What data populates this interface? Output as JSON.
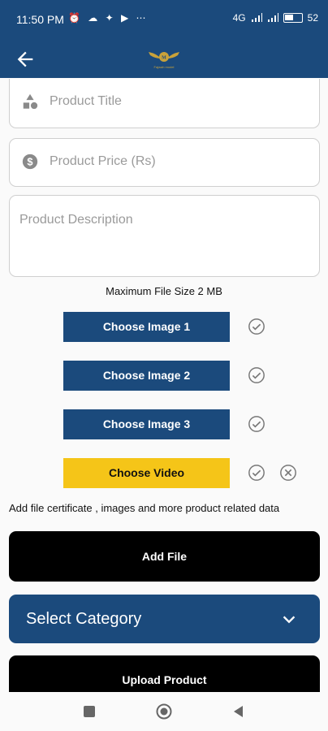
{
  "status_bar": {
    "time": "11:50 PM",
    "icons": "⏰ ☁ ✦ ▶ ⋯",
    "network": "4G",
    "battery": "52"
  },
  "app_bar": {
    "logo_text": "Fajwah model"
  },
  "form": {
    "title_placeholder": "Product Title",
    "price_placeholder": "Product Price (Rs)",
    "description_placeholder": "Product Description",
    "max_size_note": "Maximum File Size 2 MB",
    "choose_image_1": "Choose Image 1",
    "choose_image_2": "Choose Image 2",
    "choose_image_3": "Choose Image 3",
    "choose_video": "Choose Video",
    "file_note": "Add file certificate , images and more product related data",
    "add_file": "Add File",
    "select_category": "Select Category",
    "upload_product": "Upload Product"
  },
  "colors": {
    "primary": "#1b4a7c",
    "video_button": "#f5c518",
    "black_button": "#000000"
  }
}
